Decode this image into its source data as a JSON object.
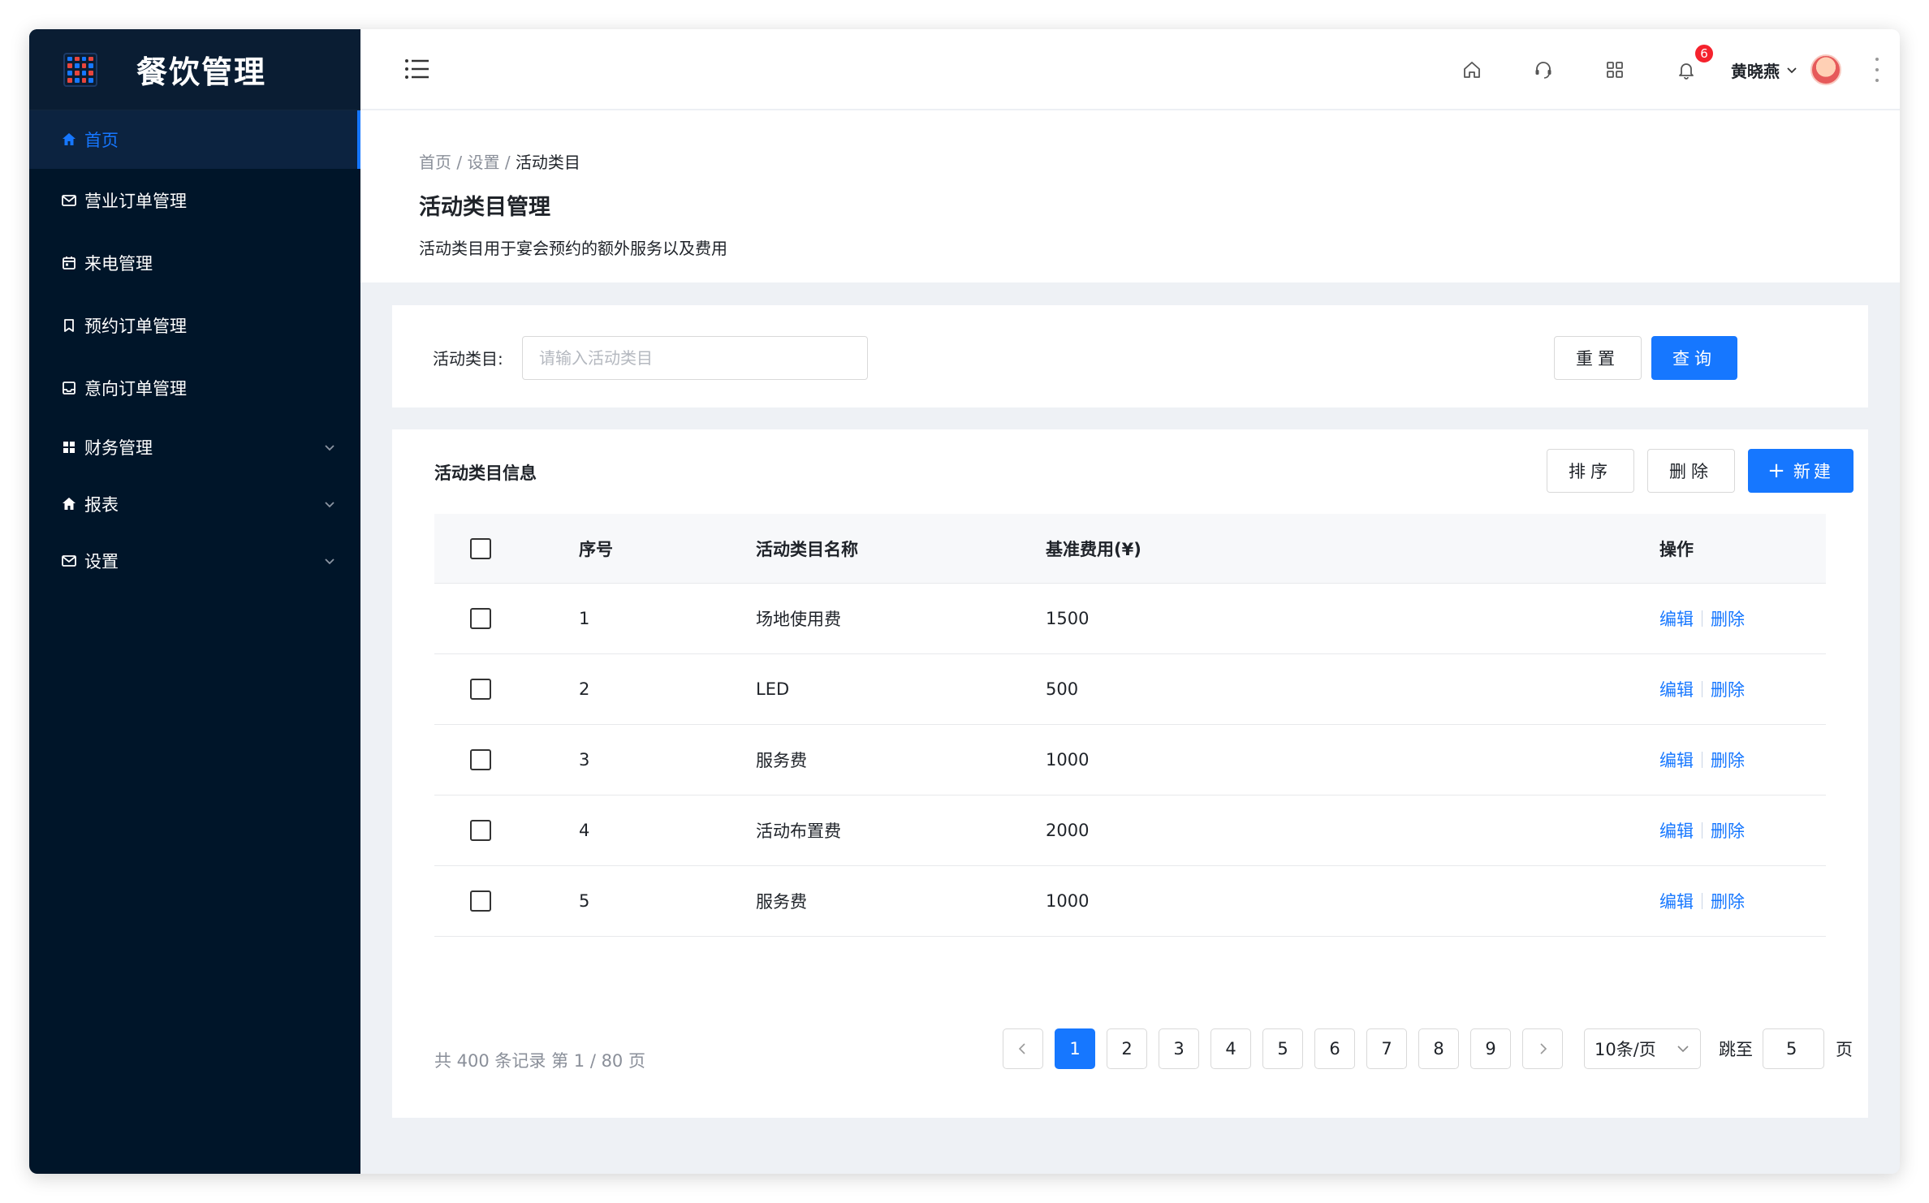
{
  "app": {
    "title": "餐饮管理"
  },
  "sidebar": {
    "items": [
      {
        "label": "首页",
        "icon": "home-icon",
        "active": true
      },
      {
        "label": "营业订单管理",
        "icon": "mail-icon"
      },
      {
        "label": "来电管理",
        "icon": "calendar-icon"
      },
      {
        "label": "预约订单管理",
        "icon": "bookmark-icon"
      },
      {
        "label": "意向订单管理",
        "icon": "inbox-icon"
      },
      {
        "label": "财务管理",
        "icon": "grid-icon",
        "expandable": true
      },
      {
        "label": "报表",
        "icon": "home-icon",
        "expandable": true
      },
      {
        "label": "设置",
        "icon": "mail-icon",
        "expandable": true
      }
    ]
  },
  "header": {
    "notification_count": "6",
    "user_name": "黄晓燕",
    "icons": [
      "home-icon",
      "headset-icon",
      "apps-icon",
      "bell-icon",
      "more-vertical-icon"
    ]
  },
  "page": {
    "breadcrumb": [
      "首页",
      "设置",
      "活动类目"
    ],
    "breadcrumb_sep": "/",
    "title": "活动类目管理",
    "description": "活动类目用于宴会预约的额外服务以及费用"
  },
  "search": {
    "label": "活动类目:",
    "placeholder": "请输入活动类目",
    "value": "",
    "reset_label": "重置",
    "query_label": "查询"
  },
  "table": {
    "title": "活动类目信息",
    "sort_label": "排序",
    "delete_label": "删除",
    "new_label": "新建",
    "columns": [
      "序号",
      "活动类目名称",
      "基准费用(¥)",
      "操作"
    ],
    "rows": [
      {
        "no": "1",
        "name": "场地使用费",
        "fee": "1500"
      },
      {
        "no": "2",
        "name": "LED",
        "fee": "500"
      },
      {
        "no": "3",
        "name": "服务费",
        "fee": "1000"
      },
      {
        "no": "4",
        "name": "活动布置费",
        "fee": "2000"
      },
      {
        "no": "5",
        "name": "服务费",
        "fee": "1000"
      }
    ],
    "edit_label": "编辑",
    "row_delete_label": "删除"
  },
  "pagination": {
    "summary": "共 400 条记录 第 1 / 80 页",
    "pages": [
      "1",
      "2",
      "3",
      "4",
      "5",
      "6",
      "7",
      "8",
      "9"
    ],
    "current": "1",
    "page_size": "10条/页",
    "jump_label": "跳至",
    "jump_value": "5",
    "jump_suffix": "页"
  },
  "colors": {
    "primary": "#1677ff",
    "sidebar_bg": "#001529",
    "badge": "#f5222d"
  }
}
